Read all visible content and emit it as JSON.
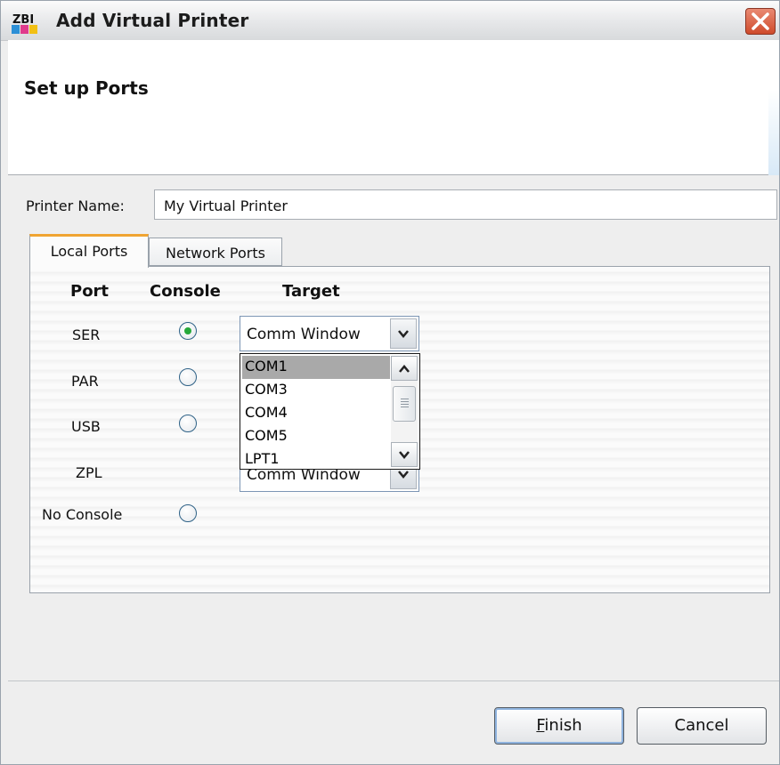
{
  "window": {
    "title": "Add Virtual Printer",
    "app_icon_text": "ZBI"
  },
  "header": {
    "title": "Set up Ports"
  },
  "printer_name": {
    "label": "Printer Name:",
    "value": "My Virtual Printer"
  },
  "tabs": [
    {
      "label": "Local Ports",
      "active": true
    },
    {
      "label": "Network Ports",
      "active": false
    }
  ],
  "table": {
    "headers": {
      "port": "Port",
      "console": "Console",
      "target": "Target"
    },
    "rows": [
      {
        "port": "SER",
        "console_selected": true,
        "target": "Comm Window"
      },
      {
        "port": "PAR",
        "console_selected": false,
        "target": ""
      },
      {
        "port": "USB",
        "console_selected": false,
        "target": ""
      },
      {
        "port": "ZPL",
        "console_selected": null,
        "target": "Comm Window"
      },
      {
        "port": "No Console",
        "console_selected": false,
        "target": null
      }
    ]
  },
  "dropdown": {
    "options": [
      "COM1",
      "COM3",
      "COM4",
      "COM5",
      "LPT1"
    ],
    "highlighted": "COM1"
  },
  "buttons": {
    "finish": "Finish",
    "cancel": "Cancel"
  },
  "colors": {
    "tab_accent": "#f0a432",
    "radio_dot": "#26a83a",
    "close_button": "#cf4b2b",
    "dropdown_highlight": "#a9a9a9"
  }
}
